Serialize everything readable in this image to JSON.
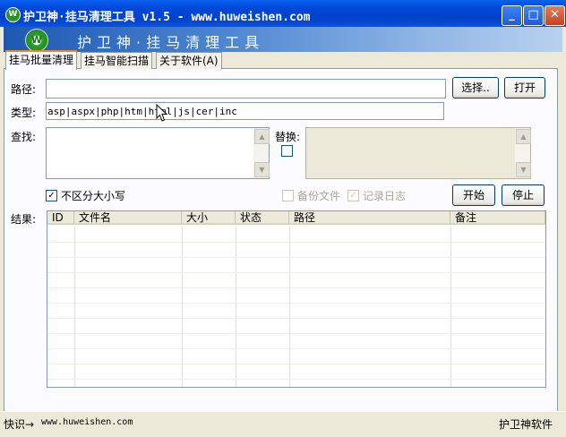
{
  "window": {
    "title": "护卫神·挂马清理工具 v1.5 - www.huweishen.com",
    "icon_letter": "W",
    "minimize_glyph": "_",
    "maximize_glyph": "□",
    "close_glyph": "✕"
  },
  "banner": {
    "logo_letter": "W",
    "title": "护卫神·挂马清理工具"
  },
  "tabs": [
    {
      "label": "挂马批量清理",
      "active": true
    },
    {
      "label": "挂马智能扫描",
      "active": false
    },
    {
      "label": "关于软件(A)",
      "active": false
    }
  ],
  "form": {
    "path_label": "路径:",
    "path_value": "",
    "type_label": "类型:",
    "type_value": "asp|aspx|php|htm|html|js|cer|inc",
    "find_label": "查找:",
    "find_value": "",
    "replace_label": "替换:",
    "replace_value": "",
    "select_button": "选择..",
    "open_button": "打开",
    "case_insensitive_label": "不区分大小写",
    "case_insensitive_checked": true,
    "backup_label": "备份文件",
    "backup_checked": false,
    "log_label": "记录日志",
    "log_checked": true,
    "start_button": "开始",
    "stop_button": "停止"
  },
  "results": {
    "label": "结果:",
    "columns": [
      "ID",
      "文件名",
      "大小",
      "状态",
      "路径",
      "备注"
    ],
    "rows": []
  },
  "statusbar": {
    "left_prefix": "快识→",
    "left_url": "www.huweishen.com",
    "right": "护卫神软件"
  },
  "icons": {
    "scroll_up": "▲",
    "scroll_down": "▼",
    "check": "✓"
  },
  "colors": {
    "titlebar": "#0048D8",
    "face": "#ECE9D8",
    "active_tab_accent": "#E68B2C"
  }
}
